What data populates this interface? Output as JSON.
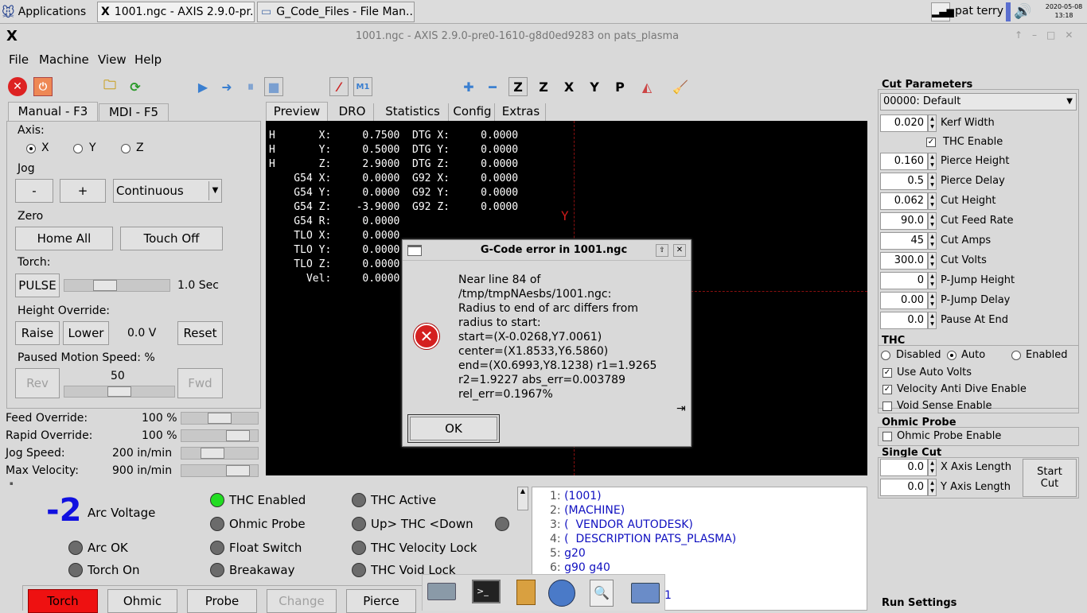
{
  "taskbar": {
    "apps_label": "Applications",
    "task1": "1001.ngc - AXIS 2.9.0-pr...",
    "task2": "G_Code_Files - File Man...",
    "user": "pat terry",
    "date": "2020-05-08",
    "time": "13:18"
  },
  "window": {
    "title": "1001.ngc - AXIS 2.9.0-pre0-1610-g8d0ed9283 on pats_plasma"
  },
  "menu": [
    "File",
    "Machine",
    "View",
    "Help"
  ],
  "tabs_left": [
    "Manual - F3",
    "MDI - F5"
  ],
  "tabs_center": [
    "Preview",
    "DRO",
    "Statistics",
    "Config",
    "Extras"
  ],
  "manual": {
    "axis_label": "Axis:",
    "axes": [
      "X",
      "Y",
      "Z"
    ],
    "jog_label": "Jog",
    "jog_minus": "-",
    "jog_plus": "+",
    "jog_mode": "Continuous",
    "zero_label": "Zero",
    "home_all": "Home All",
    "touch_off": "Touch Off",
    "torch_label": "Torch:",
    "pulse": "PULSE",
    "pulse_value": "1.0 Sec",
    "pulse_level": 0.35,
    "height_label": "Height Override:",
    "raise": "Raise",
    "lower": "Lower",
    "height_value": "0.0 V",
    "reset": "Reset",
    "paused_label": "Paused Motion Speed: %",
    "rev": "Rev",
    "paused_value": "50",
    "fwd": "Fwd",
    "paused_level": 0.5
  },
  "overrides": [
    {
      "label": "Feed Override:",
      "value": "100",
      "unit": "%",
      "level": 0.5
    },
    {
      "label": "Rapid Override:",
      "value": "100",
      "unit": "%",
      "level": 0.85
    },
    {
      "label": "Jog Speed:",
      "value": "200",
      "unit": "in/min",
      "level": 0.37
    },
    {
      "label": "Max Velocity:",
      "value": "900",
      "unit": "in/min",
      "level": 0.85
    }
  ],
  "dro": [
    [
      "H",
      "X:",
      "0.7500",
      "DTG X:",
      "0.0000"
    ],
    [
      "H",
      "Y:",
      "0.5000",
      "DTG Y:",
      "0.0000"
    ],
    [
      "H",
      "Z:",
      "2.9000",
      "DTG Z:",
      "0.0000"
    ],
    [
      "",
      "G54 X:",
      "0.0000",
      "G92 X:",
      "0.0000"
    ],
    [
      "",
      "G54 Y:",
      "0.0000",
      "G92 Y:",
      "0.0000"
    ],
    [
      "",
      "G54 Z:",
      "-3.9000",
      "G92 Z:",
      "0.0000"
    ],
    [
      "",
      "G54 R:",
      "0.0000",
      "",
      ""
    ],
    [
      "",
      "TLO X:",
      "0.0000",
      "",
      ""
    ],
    [
      "",
      "TLO Y:",
      "0.0000",
      "",
      ""
    ],
    [
      "",
      "TLO Z:",
      "0.0000",
      "",
      ""
    ],
    [
      "",
      "Vel:",
      "0.0000",
      "",
      ""
    ]
  ],
  "preview_axis": "Y",
  "dialog": {
    "title": "G-Code error in 1001.ngc",
    "lines": [
      "Near line 84 of",
      "/tmp/tmpNAesbs/1001.ngc:",
      "Radius to end of arc differs from",
      "radius to start:",
      "start=(X-0.0268,Y7.0061)",
      "center=(X1.8533,Y6.5860)",
      "end=(X0.6993,Y8.1238) r1=1.9265",
      "r2=1.9227 abs_err=0.003789",
      "rel_err=0.1967%"
    ],
    "ok": "OK"
  },
  "cut": {
    "header": "Cut Parameters",
    "material": "00000: Default",
    "params": [
      {
        "value": "0.020",
        "label": "Kerf Width"
      },
      {
        "value": "0.160",
        "label": "Pierce Height"
      },
      {
        "value": "0.5",
        "label": "Pierce Delay"
      },
      {
        "value": "0.062",
        "label": "Cut Height"
      },
      {
        "value": "90.0",
        "label": "Cut Feed Rate"
      },
      {
        "value": "45",
        "label": "Cut Amps"
      },
      {
        "value": "300.0",
        "label": "Cut Volts"
      },
      {
        "value": "0",
        "label": "P-Jump Height"
      },
      {
        "value": "0.00",
        "label": "P-Jump Delay"
      },
      {
        "value": "0.0",
        "label": "Pause At End"
      }
    ],
    "thc_enable": "THC Enable"
  },
  "thc": {
    "header": "THC",
    "modes": [
      "Disabled",
      "Auto",
      "Enabled"
    ],
    "use_auto_volts": "Use Auto Volts",
    "vad": "Velocity Anti Dive Enable",
    "void": "Void Sense Enable"
  },
  "ohmic": {
    "header": "Ohmic Probe",
    "enable": "Ohmic Probe Enable"
  },
  "single": {
    "header": "Single Cut",
    "x_val": "0.0",
    "x_label": "X Axis Length",
    "y_val": "0.0",
    "y_label": "Y Axis Length",
    "start": "Start Cut"
  },
  "run_settings": "Run Settings",
  "plasma": {
    "arc_value": "-2",
    "arc_label": "Arc Voltage",
    "arc_ok": "Arc OK",
    "torch_on": "Torch On",
    "col2": [
      "THC Enabled",
      "Ohmic Probe",
      "Float Switch",
      "Breakaway"
    ],
    "col3": [
      "THC Active",
      "Up> THC <Down",
      "THC Velocity Lock",
      "THC Void Lock"
    ]
  },
  "bottom_buttons": [
    "Torch",
    "Ohmic",
    "Probe",
    "Change",
    "Pierce"
  ],
  "gcode": [
    "(1001)",
    "(MACHINE)",
    "(  VENDOR AUTODESK)",
    "(  DESCRIPTION PATS_PLASMA)",
    "g20",
    "g90 g40"
  ],
  "gcode_partial": "1"
}
